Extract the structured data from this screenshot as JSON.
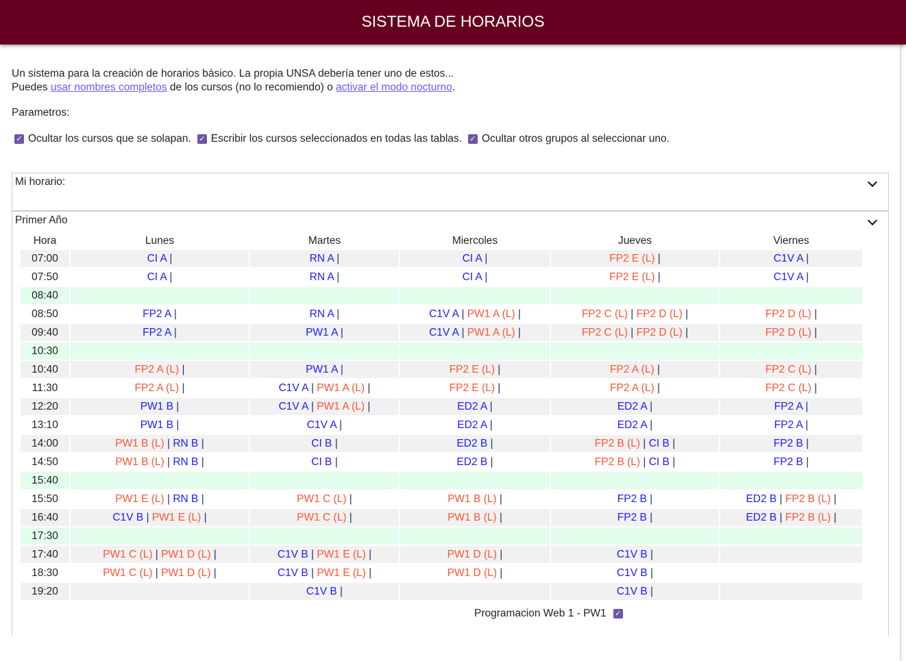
{
  "header": {
    "title": "SISTEMA DE HORARIOS"
  },
  "intro": {
    "line1": "Un sistema para la creación de horarios básico. La propia UNSA debería tener uno de estos...",
    "prefix": "Puedes ",
    "link1": "usar nombres completos",
    "middle": " de los cursos (no lo recomiendo) o ",
    "link2": "activar el modo nocturno",
    "suffix": "."
  },
  "params": {
    "label": "Parametros:",
    "options": [
      {
        "label": "Ocultar los cursos que se solapan.",
        "checked": true
      },
      {
        "label": "Escribir los cursos seleccionados en todas las tablas.",
        "checked": true
      },
      {
        "label": "Ocultar otros grupos al seleccionar uno.",
        "checked": true
      }
    ]
  },
  "my_schedule": {
    "title": "Mi horario:"
  },
  "year": {
    "title": "Primer Año",
    "headers": [
      "Hora",
      "Lunes",
      "Martes",
      "Miercoles",
      "Jueves",
      "Viernes"
    ],
    "rows": [
      {
        "time": "07:00",
        "cells": [
          [
            "CI A"
          ],
          [
            "RN A"
          ],
          [
            "CI A"
          ],
          [
            "FP2 E (L)"
          ],
          [
            "C1V A"
          ]
        ]
      },
      {
        "time": "07:50",
        "cells": [
          [
            "CI A"
          ],
          [
            "RN A"
          ],
          [
            "CI A"
          ],
          [
            "FP2 E (L)"
          ],
          [
            "C1V A"
          ]
        ]
      },
      {
        "time": "08:40",
        "break": true,
        "cells": [
          [],
          [],
          [],
          [],
          []
        ]
      },
      {
        "time": "08:50",
        "cells": [
          [
            "FP2 A"
          ],
          [
            "RN A"
          ],
          [
            "C1V A",
            "PW1 A (L)"
          ],
          [
            "FP2 C (L)",
            "FP2 D (L)"
          ],
          [
            "FP2 D (L)"
          ]
        ]
      },
      {
        "time": "09:40",
        "cells": [
          [
            "FP2 A"
          ],
          [
            "PW1 A"
          ],
          [
            "C1V A",
            "PW1 A (L)"
          ],
          [
            "FP2 C (L)",
            "FP2 D (L)"
          ],
          [
            "FP2 D (L)"
          ]
        ]
      },
      {
        "time": "10:30",
        "break": true,
        "cells": [
          [],
          [],
          [],
          [],
          []
        ]
      },
      {
        "time": "10:40",
        "cells": [
          [
            "FP2 A (L)"
          ],
          [
            "PW1 A"
          ],
          [
            "FP2 E (L)"
          ],
          [
            "FP2 A (L)"
          ],
          [
            "FP2 C (L)"
          ]
        ]
      },
      {
        "time": "11:30",
        "cells": [
          [
            "FP2 A (L)"
          ],
          [
            "C1V A",
            "PW1 A (L)"
          ],
          [
            "FP2 E (L)"
          ],
          [
            "FP2 A (L)"
          ],
          [
            "FP2 C (L)"
          ]
        ]
      },
      {
        "time": "12:20",
        "cells": [
          [
            "PW1 B"
          ],
          [
            "C1V A",
            "PW1 A (L)"
          ],
          [
            "ED2 A"
          ],
          [
            "ED2 A"
          ],
          [
            "FP2 A"
          ]
        ]
      },
      {
        "time": "13:10",
        "cells": [
          [
            "PW1 B"
          ],
          [
            "C1V A"
          ],
          [
            "ED2 A"
          ],
          [
            "ED2 A"
          ],
          [
            "FP2 A"
          ]
        ]
      },
      {
        "time": "14:00",
        "cells": [
          [
            "PW1 B (L)",
            "RN B"
          ],
          [
            "CI B"
          ],
          [
            "ED2 B"
          ],
          [
            "FP2 B (L)",
            "CI B"
          ],
          [
            "FP2 B"
          ]
        ]
      },
      {
        "time": "14:50",
        "cells": [
          [
            "PW1 B (L)",
            "RN B"
          ],
          [
            "CI B"
          ],
          [
            "ED2 B"
          ],
          [
            "FP2 B (L)",
            "CI B"
          ],
          [
            "FP2 B"
          ]
        ]
      },
      {
        "time": "15:40",
        "break": true,
        "cells": [
          [],
          [],
          [],
          [],
          []
        ]
      },
      {
        "time": "15:50",
        "cells": [
          [
            "PW1 E (L)",
            "RN B"
          ],
          [
            "PW1 C (L)"
          ],
          [
            "PW1 B (L)"
          ],
          [
            "FP2 B"
          ],
          [
            "ED2 B",
            "FP2 B (L)"
          ]
        ]
      },
      {
        "time": "16:40",
        "cells": [
          [
            "C1V B",
            "PW1 E (L)"
          ],
          [
            "PW1 C (L)"
          ],
          [
            "PW1 B (L)"
          ],
          [
            "FP2 B"
          ],
          [
            "ED2 B",
            "FP2 B (L)"
          ]
        ]
      },
      {
        "time": "17:30",
        "break": true,
        "cells": [
          [],
          [],
          [],
          [],
          []
        ]
      },
      {
        "time": "17:40",
        "cells": [
          [
            "PW1 C (L)",
            "PW1 D (L)"
          ],
          [
            "C1V B",
            "PW1 E (L)"
          ],
          [
            "PW1 D (L)"
          ],
          [
            "C1V B"
          ],
          []
        ]
      },
      {
        "time": "18:30",
        "cells": [
          [
            "PW1 C (L)",
            "PW1 D (L)"
          ],
          [
            "C1V B",
            "PW1 E (L)"
          ],
          [
            "PW1 D (L)"
          ],
          [
            "C1V B"
          ],
          []
        ]
      },
      {
        "time": "19:20",
        "cells": [
          [],
          [
            "C1V B"
          ],
          [],
          [
            "C1V B"
          ],
          []
        ]
      }
    ],
    "course_label": "Programacion Web 1 - PW1",
    "course_checked": true
  },
  "colors": {
    "header": "#650020",
    "theory": "#1a1aff",
    "lab": "#ff5533",
    "break": "#e3fdec"
  }
}
